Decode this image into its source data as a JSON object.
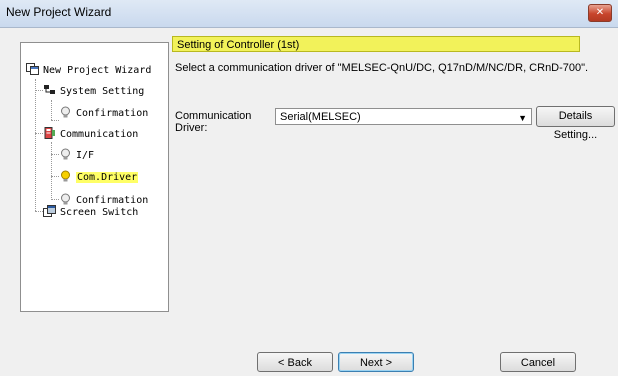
{
  "window": {
    "title": "New Project Wizard",
    "close_glyph": "✕"
  },
  "tree": {
    "items": [
      {
        "label": "New Project Wizard",
        "icon": "project-icon"
      },
      {
        "label": "System Setting",
        "icon": "network-icon"
      },
      {
        "label": "Confirmation",
        "icon": "lightbulb-icon"
      },
      {
        "label": "Communication",
        "icon": "communication-icon"
      },
      {
        "label": "I/F",
        "icon": "lightbulb-icon"
      },
      {
        "label": "Com.Driver",
        "icon": "lightbulb-icon",
        "selected": true
      },
      {
        "label": "Confirmation",
        "icon": "lightbulb-icon"
      },
      {
        "label": "Screen Switch",
        "icon": "screen-switch-icon"
      }
    ]
  },
  "main": {
    "section_title": "Setting of Controller (1st)",
    "description": "Select a communication driver of \"MELSEC-QnU/DC, Q17nD/M/NC/DR, CRnD-700\".",
    "driver_label": "Communication Driver:",
    "driver_value": "Serial(MELSEC)",
    "details_button": "Details Setting..."
  },
  "footer": {
    "back": "< Back",
    "next": "Next >",
    "cancel": "Cancel"
  },
  "colors": {
    "highlight": "#ffff66",
    "section_bg": "#f2f25a"
  }
}
